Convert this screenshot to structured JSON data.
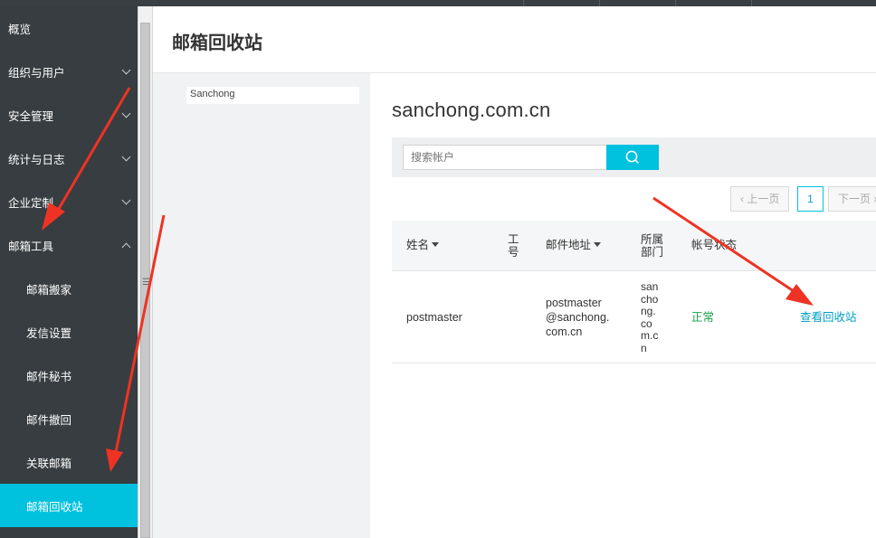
{
  "sidebar": {
    "items": [
      {
        "label": "概览"
      },
      {
        "label": "组织与用户"
      },
      {
        "label": "安全管理"
      },
      {
        "label": "统计与日志"
      },
      {
        "label": "企业定制"
      },
      {
        "label": "邮箱工具"
      },
      {
        "label": "邮箱搬家"
      },
      {
        "label": "发信设置"
      },
      {
        "label": "邮件秘书"
      },
      {
        "label": "邮件撤回"
      },
      {
        "label": "关联邮箱"
      },
      {
        "label": "邮箱回收站"
      }
    ]
  },
  "page": {
    "title": "邮箱回收站"
  },
  "tree": {
    "root_label": "Sanchong"
  },
  "main": {
    "domain": "sanchong.com.cn",
    "search": {
      "placeholder": "搜索帐户"
    },
    "pager": {
      "prev": "‹ 上一页",
      "current": "1",
      "next": "下一页 ›"
    }
  },
  "table": {
    "headers": {
      "name": "姓名",
      "id_line1": "工",
      "id_line2": "号",
      "email": "邮件地址",
      "dept_line1": "所属",
      "dept_line2": "部门",
      "status": "帐号状态"
    },
    "rows": [
      {
        "name": "postmaster",
        "email_line1": "postmaster",
        "email_line2": "@sanchong.",
        "email_line3": "com.cn",
        "dept_lines": [
          "san",
          "cho",
          "ng.",
          "co",
          "m.c",
          "n"
        ],
        "status": "正常",
        "action": "查看回收站"
      }
    ]
  },
  "colors": {
    "sidebar_bg": "#373d41",
    "accent": "#00c1de",
    "status_ok": "#1aa04a",
    "annotation_arrow": "#ee3324"
  }
}
